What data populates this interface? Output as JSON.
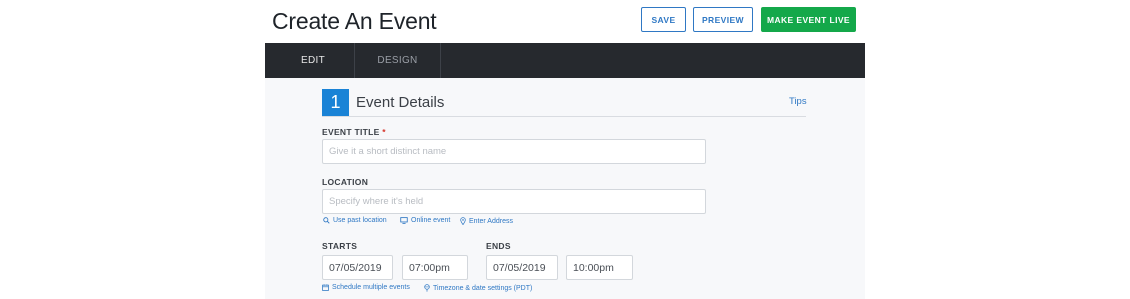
{
  "header": {
    "title": "Create An Event",
    "save_label": "SAVE",
    "preview_label": "PREVIEW",
    "live_label": "MAKE EVENT LIVE"
  },
  "tabs": [
    {
      "label": "EDIT",
      "active": true
    },
    {
      "label": "DESIGN",
      "active": false
    }
  ],
  "section": {
    "number": "1",
    "title": "Event Details",
    "tips": "Tips"
  },
  "form": {
    "event_title": {
      "label": "EVENT TITLE",
      "required_mark": "*",
      "placeholder": "Give it a short distinct name",
      "value": ""
    },
    "location": {
      "label": "LOCATION",
      "placeholder": "Specify where it's held",
      "value": "",
      "links": [
        "Use past location",
        "Online event",
        "Enter Address"
      ]
    },
    "starts": {
      "label": "STARTS",
      "date": "07/05/2019",
      "time": "07:00pm"
    },
    "ends": {
      "label": "ENDS",
      "date": "07/05/2019",
      "time": "10:00pm"
    },
    "schedule_links": [
      "Schedule multiple events",
      "Timezone & date settings (PDT)"
    ]
  },
  "colors": {
    "accent_blue": "#2f78c4",
    "badge_blue": "#1a83d6",
    "live_green": "#14a84a",
    "tabbar_dark": "#26292e",
    "required_red": "#d6352b"
  },
  "icons": [
    "search-icon",
    "monitor-icon",
    "map-pin-icon",
    "calendar-icon",
    "globe-pin-icon"
  ]
}
